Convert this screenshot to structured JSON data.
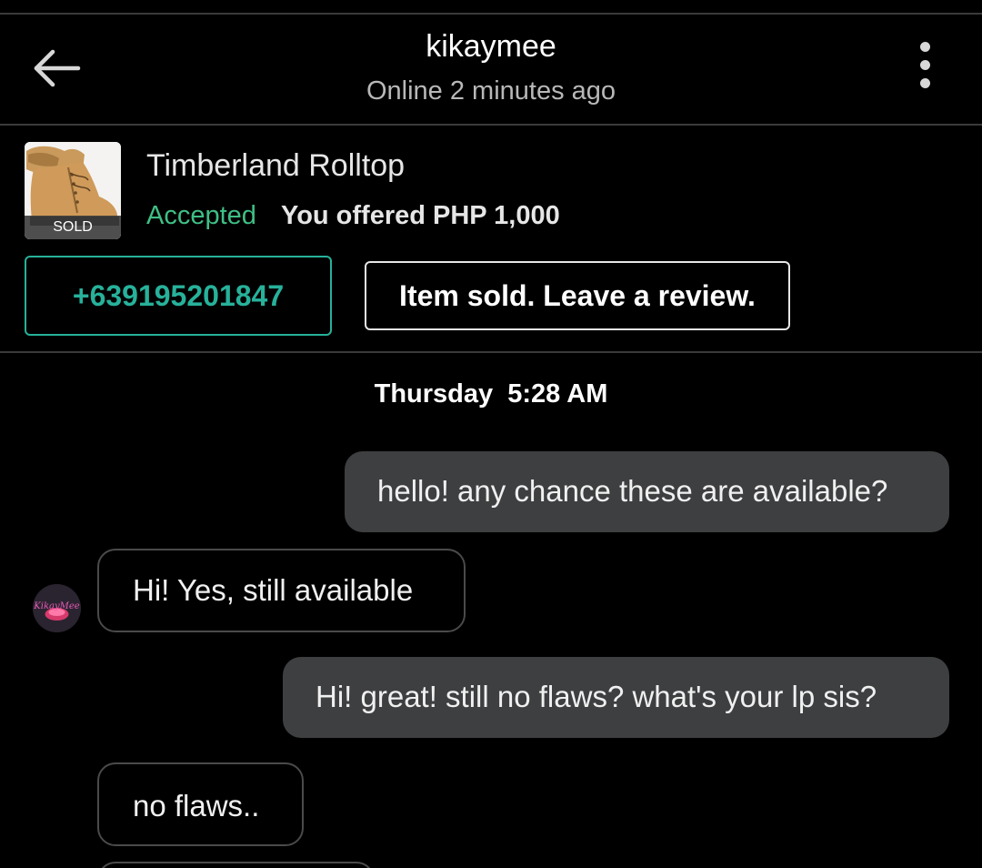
{
  "header": {
    "title": "kikaymee",
    "subtitle": "Online 2 minutes ago",
    "back_icon": "arrow-left-icon",
    "more_icon": "more-vertical-icon"
  },
  "product": {
    "name": "Timberland Rolltop",
    "sold_label": "SOLD",
    "status": "Accepted",
    "offer_text": "You offered PHP 1,000",
    "phone_button": "+639195201847",
    "review_button": "Item sold. Leave a review."
  },
  "chat": {
    "timestamp": "Thursday  5:28 AM",
    "messages": [
      {
        "side": "out",
        "text": "hello! any chance these are available?"
      },
      {
        "side": "in",
        "text": "Hi! Yes, still available"
      },
      {
        "side": "out",
        "text": "Hi! great! still no flaws? what's your lp sis?"
      },
      {
        "side": "in",
        "text": "no flaws.."
      }
    ],
    "avatar_text": "KikayMee"
  },
  "colors": {
    "background": "#000000",
    "accent_teal": "#27b19a",
    "accepted_green": "#3fbf85",
    "outgoing_bubble": "#3e3f41",
    "divider": "#3a3a3a"
  }
}
